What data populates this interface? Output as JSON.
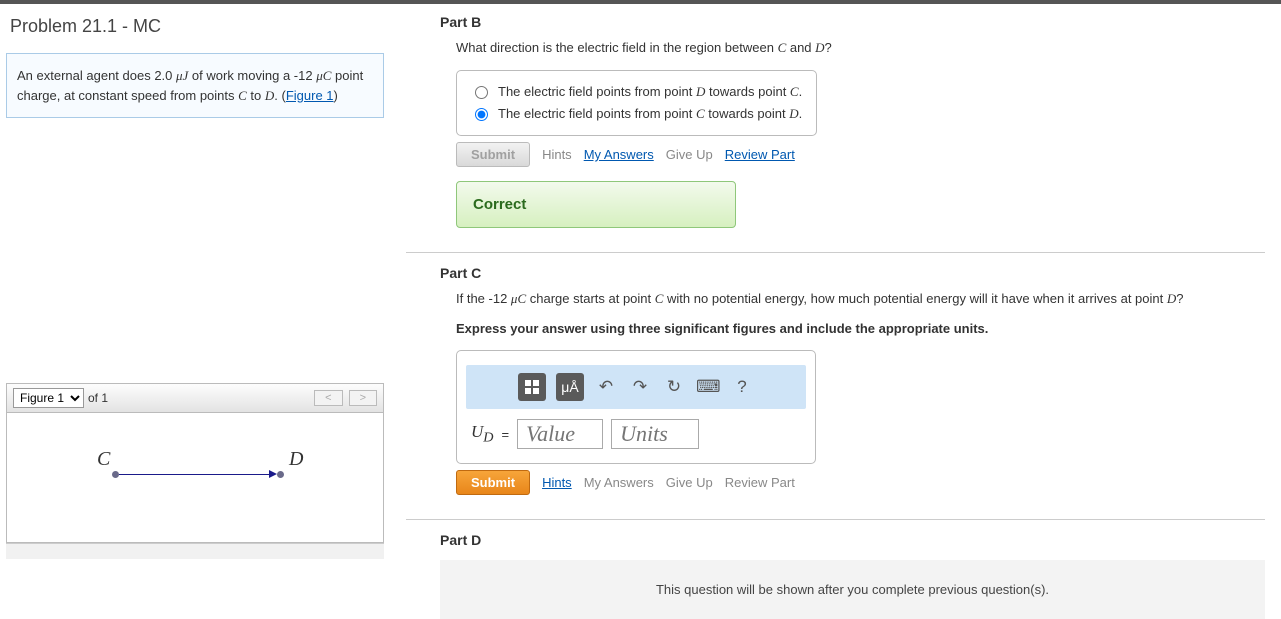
{
  "problem_title": "Problem 21.1 - MC",
  "problem_text_1": "An external agent does 2.0 ",
  "problem_unit1": "μJ",
  "problem_text_2": "  of work moving a -12 ",
  "problem_unit2": "μC",
  "problem_text_3": " point charge, at constant speed from points ",
  "point_c": "C",
  "to_word": " to ",
  "point_d": "D",
  "period": ".  (",
  "figure_link": "Figure 1",
  "close_paren": ")",
  "figure": {
    "select": "Figure 1",
    "of_text": "of 1",
    "label_c": "C",
    "label_d": "D"
  },
  "partB": {
    "title": "Part B",
    "prompt_1": "What direction is the electric field in the region between ",
    "prompt_c": "C",
    "prompt_and": " and ",
    "prompt_d": "D",
    "prompt_q": "?",
    "opt1_a": "The electric field points from point ",
    "opt1_b": "D",
    "opt1_c": " towards point ",
    "opt1_d": "C",
    "opt1_e": ".",
    "opt2_a": "The electric field points from point ",
    "opt2_b": "C",
    "opt2_c": " towards point ",
    "opt2_d": "D",
    "opt2_e": ".",
    "submit": "Submit",
    "hints": "Hints",
    "my_answers": "My Answers",
    "give_up": "Give Up",
    "review": "Review Part",
    "feedback": "Correct"
  },
  "partC": {
    "title": "Part C",
    "prompt_1": "If the -12 ",
    "prompt_unit": "μC",
    "prompt_2": " charge starts at point ",
    "prompt_c": "C",
    "prompt_3": " with no potential energy, how much potential energy will it have when it arrives at point ",
    "prompt_d": "D",
    "prompt_q": "?",
    "instr": "Express your answer using three significant figures and include the appropriate units.",
    "ud_label": "U",
    "ud_sub": "D",
    "equals": "=",
    "value_ph": "Value",
    "units_ph": "Units",
    "tool_ua": "μÅ",
    "submit": "Submit",
    "hints": "Hints",
    "my_answers": "My Answers",
    "give_up": "Give Up",
    "review": "Review Part"
  },
  "partD": {
    "title": "Part D",
    "locked": "This question will be shown after you complete previous question(s)."
  }
}
